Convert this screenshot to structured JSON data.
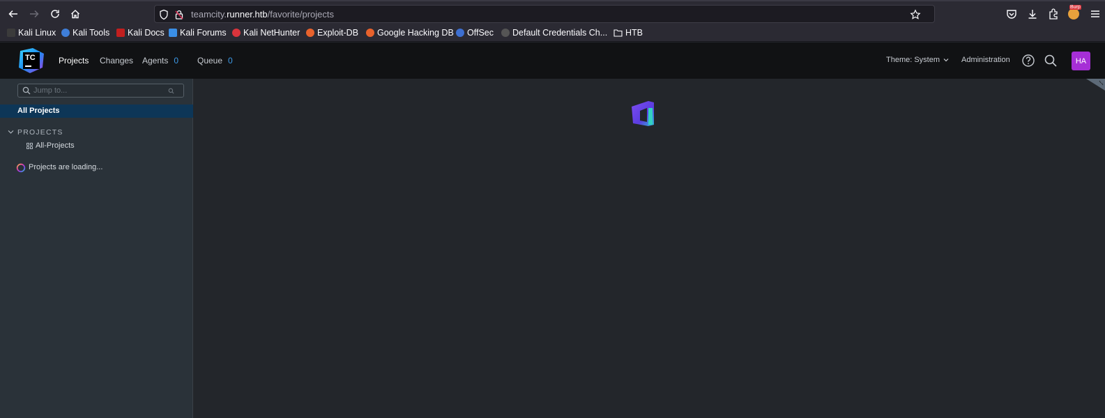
{
  "browser": {
    "url_prefix": "teamcity.",
    "url_domain": "runner.htb",
    "url_path": "/favorite/projects",
    "burp_label": "Burp",
    "bookmarks": [
      {
        "label": "Kali Linux",
        "color": "#3b3b3b"
      },
      {
        "label": "Kali Tools",
        "color": "#3f7ed8"
      },
      {
        "label": "Kali Docs",
        "color": "#c21f1f"
      },
      {
        "label": "Kali Forums",
        "color": "#3a8ee6"
      },
      {
        "label": "Kali NetHunter",
        "color": "#d9343c"
      },
      {
        "label": "Exploit-DB",
        "color": "#e8622c"
      },
      {
        "label": "Google Hacking DB",
        "color": "#e8622c"
      },
      {
        "label": "OffSec",
        "color": "#3d6fd1"
      },
      {
        "label": "Default Credentials Ch...",
        "color": "#555"
      },
      {
        "label": "HTB",
        "color": "transparent"
      }
    ]
  },
  "header": {
    "logo_text": "TC",
    "nav": [
      {
        "label": "Projects"
      },
      {
        "label": "Changes"
      },
      {
        "label": "Agents",
        "count": "0"
      },
      {
        "label": "Queue",
        "count": "0"
      }
    ],
    "theme_label": "Theme: System",
    "admin_label": "Administration",
    "avatar_initials": "HA"
  },
  "sidebar": {
    "search_placeholder": "Jump to...",
    "all_projects": "All Projects",
    "section_title": "PROJECTS",
    "project_item": "All-Projects",
    "loading_text": "Projects are loading..."
  },
  "colors": {
    "accent": "#3d9ae8",
    "selected_row": "#0d3657",
    "avatar": "#a62fd6"
  }
}
